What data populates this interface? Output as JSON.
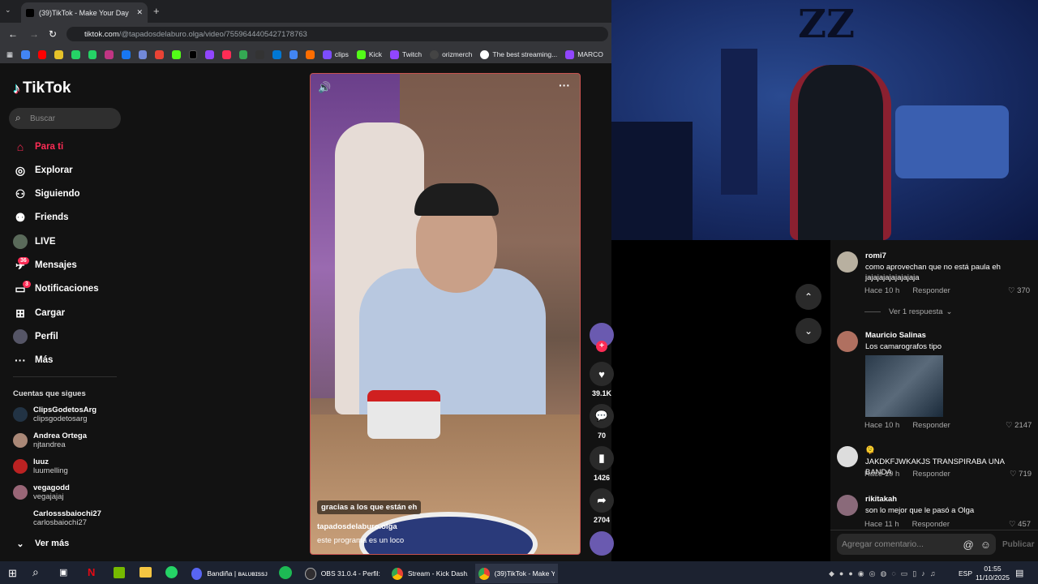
{
  "browser": {
    "tab_title": "(39)TikTok - Make Your Day",
    "url_domain": "tiktok.com",
    "url_path": "/@tapadosdelaburo.olga/video/7559644405427178763",
    "bookmarks": [
      "clips",
      "Kick",
      "Twitch",
      "orizmerch",
      "The best streaming...",
      "MARCO"
    ]
  },
  "tiktok": {
    "logo": "TikTok",
    "search_placeholder": "Buscar",
    "nav": [
      {
        "label": "Para ti",
        "icon": "home-icon"
      },
      {
        "label": "Explorar",
        "icon": "compass-icon"
      },
      {
        "label": "Siguiendo",
        "icon": "following-icon"
      },
      {
        "label": "Friends",
        "icon": "friends-icon"
      },
      {
        "label": "LIVE",
        "icon": "live-icon"
      },
      {
        "label": "Mensajes",
        "icon": "message-icon",
        "badge": "36"
      },
      {
        "label": "Notificaciones",
        "icon": "bell-icon",
        "badge": "3"
      },
      {
        "label": "Cargar",
        "icon": "plus-icon"
      },
      {
        "label": "Perfil",
        "icon": "profile-icon"
      },
      {
        "label": "Más",
        "icon": "more-icon"
      }
    ],
    "following_title": "Cuentas que sigues",
    "following": [
      {
        "name": "ClipsGodetosArg",
        "handle": "clipsgodetosarg"
      },
      {
        "name": "Andrea Ortega",
        "handle": "njtandrea"
      },
      {
        "name": "luuz",
        "handle": "luumelling"
      },
      {
        "name": "vegagodd",
        "handle": "vegajajaj"
      },
      {
        "name": "Carlosssbaiochi27",
        "handle": "carlosbaiochi27"
      }
    ],
    "see_more": "Ver más",
    "video": {
      "caption_overlay": "gracias a los que están eh",
      "author": "tapadosdelaburo.olga",
      "description": "este programa es un loco"
    },
    "actions": {
      "likes": "39.1K",
      "comments": "70",
      "saves": "1426",
      "shares": "2704"
    }
  },
  "webcam": {
    "wall_text": "ZZ"
  },
  "comments": [
    {
      "user": "romi7",
      "text": "como aprovechan que no está paula eh jajajajajajajajaja",
      "time": "Hace 10 h",
      "reply": "Responder",
      "likes": "370",
      "replies": "Ver 1 respuesta"
    },
    {
      "user": "Mauricio Salinas",
      "text": "Los camarografos tipo",
      "time": "Hace 10 h",
      "reply": "Responder",
      "likes": "2147"
    },
    {
      "user": "🫠",
      "text": "JAKDKFJWKAKJS TRANSPIRABA UNA BANDA",
      "time": "Hace 10 h",
      "reply": "Responder",
      "likes": "719"
    },
    {
      "user": "rikitakah",
      "text": "son lo mejor que le pasó a Olga",
      "time": "Hace 11 h",
      "reply": "Responder",
      "likes": "457"
    }
  ],
  "comment_input": {
    "placeholder": "Agregar comentario...",
    "post": "Publicar"
  },
  "taskbar": {
    "apps": [
      "Bandiña | ʙᴀʟᴜʙɪssᴊ ...",
      "OBS 31.0.4 - Perfil: ...",
      "Stream - Kick Dash...",
      "(39)TikTok - Make Y..."
    ],
    "lang": "ESP",
    "time": "01:55",
    "date": "11/10/2025"
  },
  "colors": {
    "tiktok_red": "#fe2c55",
    "taskbar": "#1c2230"
  }
}
